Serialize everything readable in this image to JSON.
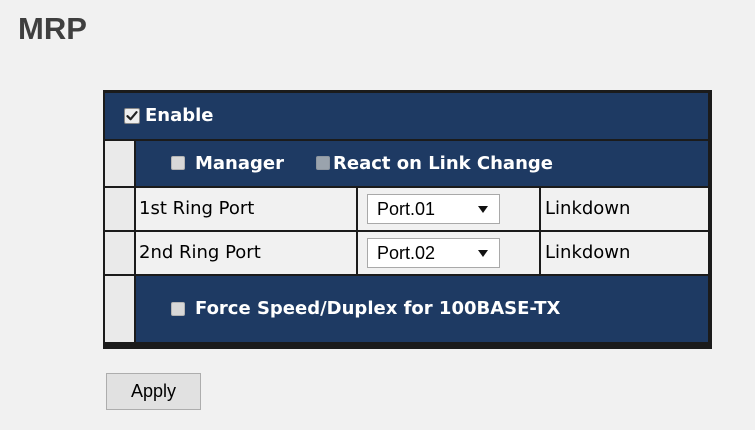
{
  "page": {
    "title": "MRP"
  },
  "settings": {
    "enable": {
      "label": "Enable",
      "checked": true
    },
    "manager": {
      "label": "Manager",
      "checked": false
    },
    "react_on_link_change": {
      "label": "React on Link Change",
      "checked": false,
      "disabled": true
    },
    "ring_ports": [
      {
        "label": "1st Ring Port",
        "port": "Port.01",
        "status": "Linkdown"
      },
      {
        "label": "2nd Ring Port",
        "port": "Port.02",
        "status": "Linkdown"
      }
    ],
    "force_speed": {
      "label": "Force Speed/Duplex for 100BASE-TX",
      "checked": false
    }
  },
  "actions": {
    "apply_label": "Apply"
  },
  "colors": {
    "header_bg": "#1e3a63",
    "page_bg": "#f1f1f1",
    "title_color": "#3f3f3f"
  }
}
